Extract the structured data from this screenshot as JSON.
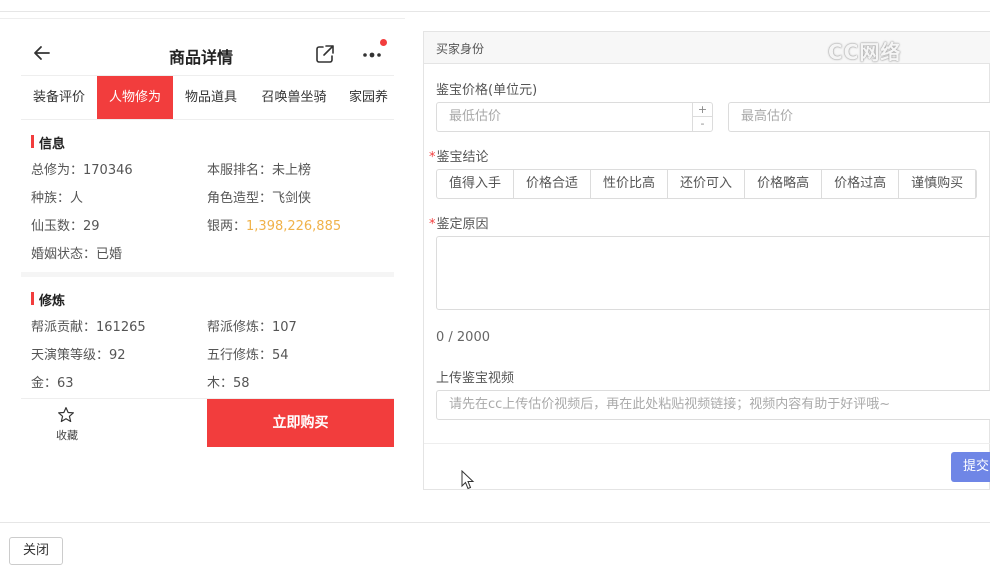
{
  "header": {
    "title": "商品详情"
  },
  "tabs": [
    {
      "label": "装备评价"
    },
    {
      "label": "人物修为",
      "active": true
    },
    {
      "label": "物品道具"
    },
    {
      "label": "召唤兽坐骑"
    },
    {
      "label": "家园养"
    }
  ],
  "info": {
    "title": "信息",
    "items": [
      {
        "label": "总修为：",
        "value": "170346"
      },
      {
        "label": "本服排名：",
        "value": "未上榜"
      },
      {
        "label": "种族：",
        "value": "人"
      },
      {
        "label": "角色造型：",
        "value": "飞剑侠"
      },
      {
        "label": "仙玉数：",
        "value": "29"
      },
      {
        "label": "银两：",
        "value": "1,398,226,885"
      },
      {
        "label": "婚姻状态：",
        "value": "已婚"
      }
    ]
  },
  "cultivation": {
    "title": "修炼",
    "items": [
      {
        "label": "帮派贡献：",
        "value": "161265"
      },
      {
        "label": "帮派修炼：",
        "value": "107"
      },
      {
        "label": "天演策等级：",
        "value": "92"
      },
      {
        "label": "五行修炼：",
        "value": "54"
      },
      {
        "label": "金：",
        "value": "63"
      },
      {
        "label": "木：",
        "value": "58"
      }
    ]
  },
  "bottom_bar": {
    "favorite_label": "收藏",
    "buy_label": "立即购买"
  },
  "panel": {
    "title": "买家身份",
    "price_label": "鉴宝价格(单位元)",
    "min_placeholder": "最低估价",
    "max_placeholder": "最高估价",
    "stepper_up": "+",
    "stepper_down": "-",
    "conclusion_label": "鉴宝结论",
    "conclusion_options": [
      "值得入手",
      "价格合适",
      "性价比高",
      "还价可入",
      "价格略高",
      "价格过高",
      "谨慎购买"
    ],
    "reason_label": "鉴定原因",
    "char_count": "0 / 2000",
    "video_label": "上传鉴宝视频",
    "video_placeholder": "请先在cc上传估价视频后，再在此处粘贴视频链接；视频内容有助于好评哦~",
    "submit_label": "提交"
  },
  "watermark": "CC网络",
  "close_label": "关闭",
  "colors": {
    "accent_red": "#f23d3d",
    "gold": "#f0b24a",
    "submit_blue": "#6f86e6"
  }
}
